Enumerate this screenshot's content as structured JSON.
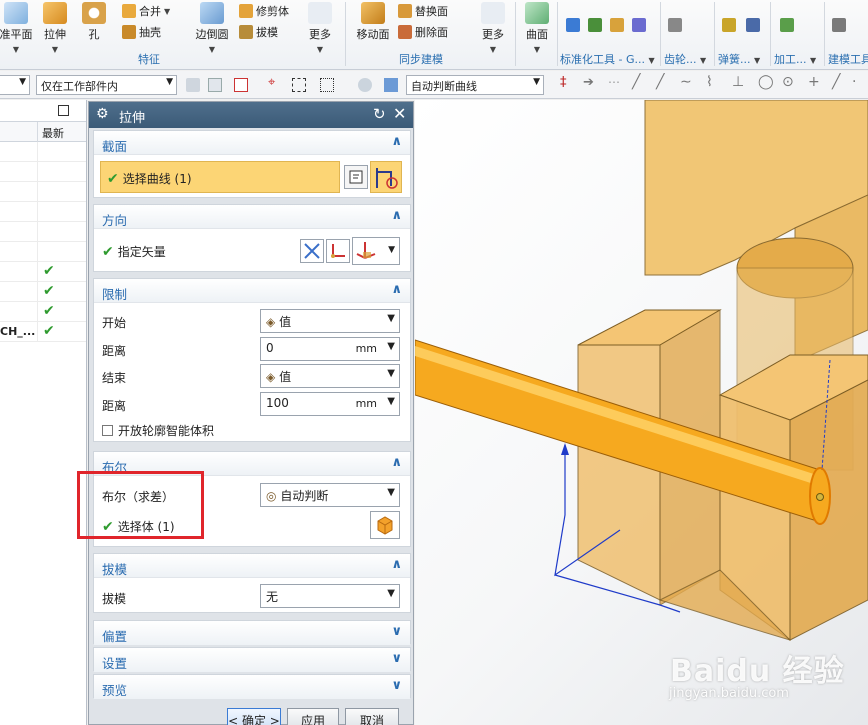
{
  "ribbon": {
    "datum_plane": "准平面",
    "extrude": "拉伸",
    "hole": "孔",
    "unite": "合并",
    "shell": "抽壳",
    "edge_blend": "边倒圆",
    "trim_body": "修剪体",
    "draft": "拔模",
    "more1": "更多",
    "feature_group": "特征",
    "move_face": "移动面",
    "replace_face": "替换面",
    "delete_face": "删除面",
    "more2": "更多",
    "sync_group": "同步建模",
    "surface": "曲面",
    "std_parts": "标准化工具 - G...",
    "gear": "齿轮...",
    "spring": "弹簧...",
    "machining": "加工...",
    "build_tools": "建模工具"
  },
  "toolbar": {
    "filter_scope": "仅在工作部件内",
    "curve_rule": "自动判断曲线"
  },
  "navigator": {
    "col_latest": "最新",
    "rows": [
      {
        "text": "",
        "check": false
      },
      {
        "text": "",
        "check": false
      },
      {
        "text": "",
        "check": false
      },
      {
        "text": "",
        "check": false
      },
      {
        "text": "",
        "check": false
      },
      {
        "text": "",
        "check": false
      },
      {
        "text": "",
        "check": true
      },
      {
        "text": "",
        "check": true
      },
      {
        "text": "",
        "check": true
      },
      {
        "text": "CH_...",
        "check": true
      }
    ],
    "check_glyph": "✔"
  },
  "dialog": {
    "title": "拉伸",
    "section_section": "截面",
    "select_curve": "选择曲线 (1)",
    "section_direction": "方向",
    "specify_vector": "指定矢量",
    "section_limits": "限制",
    "start_label": "开始",
    "start_value": "值",
    "distance_label": "距离",
    "start_distance": "0",
    "end_label": "结束",
    "end_value": "值",
    "end_distance": "100",
    "unit": "mm",
    "open_profile": "开放轮廓智能体积",
    "section_boolean": "布尔",
    "boolean_label": "布尔（求差）",
    "boolean_value": "自动判断",
    "select_body": "选择体 (1)",
    "section_draft": "拔模",
    "draft_label": "拔模",
    "draft_value": "无",
    "section_offset": "偏置",
    "section_settings": "设置",
    "section_preview": "预览",
    "ok_button": "< 确定 >",
    "apply_button": "应用",
    "cancel_button": "取消"
  },
  "watermark": {
    "main": "Baidu 经验",
    "sub": "jingyan.baidu.com"
  },
  "colors": {
    "part_orange": "#f2b84b",
    "rod_orange": "#f5a623",
    "section_blue": "#2b6cb0",
    "highlight_yellow": "#fcd575",
    "check_green": "#2f9b2f",
    "callout_red": "#e0252b"
  }
}
